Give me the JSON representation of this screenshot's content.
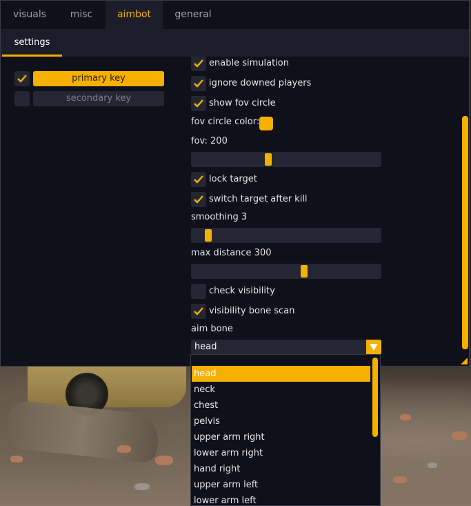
{
  "tabs": [
    "visuals",
    "misc",
    "aimbot",
    "general"
  ],
  "active_tab": "aimbot",
  "subtab": "settings",
  "keys": {
    "primary": {
      "label": "primary key",
      "checked": true
    },
    "secondary": {
      "label": "secondary key",
      "checked": false
    }
  },
  "settings": {
    "enable_simulation": {
      "label": "enable simulation",
      "checked": true
    },
    "ignore_downed": {
      "label": "ignore downed players",
      "checked": true
    },
    "show_fov_circle": {
      "label": "show fov circle",
      "checked": true
    },
    "fov_circle_color": {
      "label": "fov circle color:",
      "color": "#f5b000"
    },
    "fov": {
      "label": "fov: 200",
      "value": 200
    },
    "lock_target": {
      "label": "lock target",
      "checked": true
    },
    "switch_target": {
      "label": "switch target after kill",
      "checked": true
    },
    "smoothing": {
      "label": "smoothing 3",
      "value": 3
    },
    "max_distance": {
      "label": "max distance 300",
      "value": 300
    },
    "check_visibility": {
      "label": "check visibility",
      "checked": false
    },
    "visibility_bone_scan": {
      "label": "visibility bone scan",
      "checked": true
    },
    "aim_bone": {
      "label": "aim bone",
      "selected": "head"
    }
  },
  "aim_bone_options": [
    "head",
    "neck",
    "chest",
    "pelvis",
    "upper arm right",
    "lower arm right",
    "hand right",
    "upper arm left",
    "lower arm left"
  ],
  "colors": {
    "accent": "#f5b000",
    "panel": "#0f1019",
    "control": "#252634"
  }
}
